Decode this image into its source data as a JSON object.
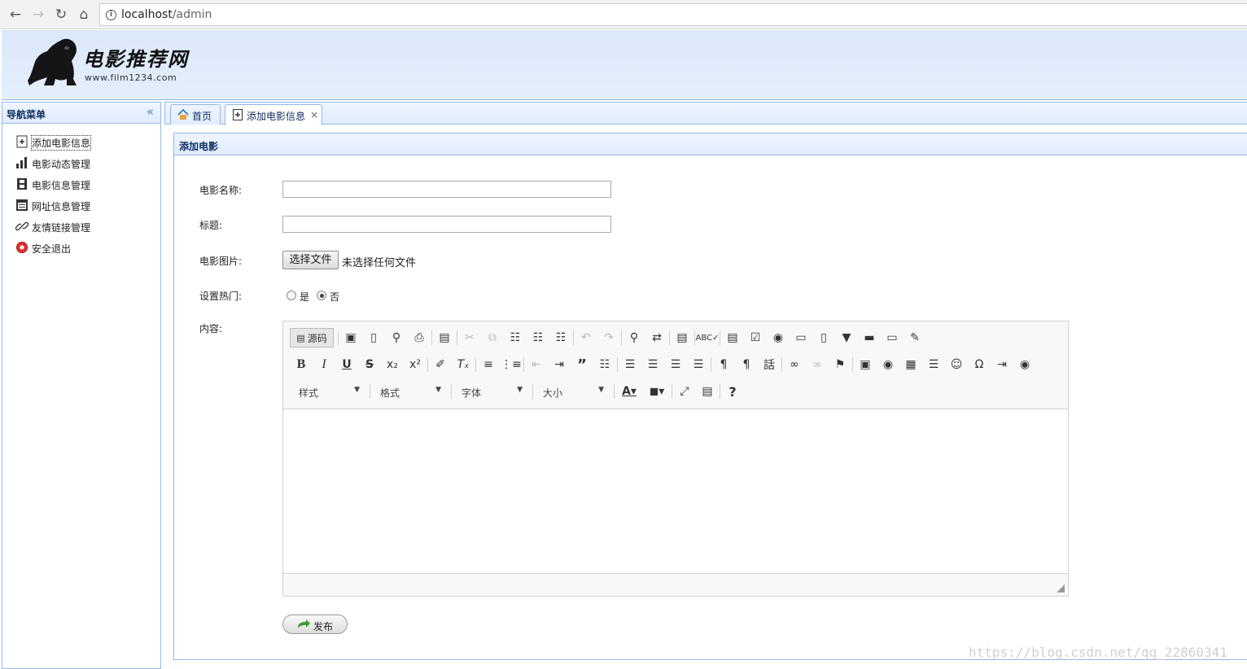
{
  "browser": {
    "url_host": "localhost",
    "url_path": "/admin"
  },
  "header": {
    "site_title": "电影推荐网",
    "site_url": "www.film1234.com"
  },
  "sidebar": {
    "title": "导航菜单",
    "items": [
      {
        "label": "添加电影信息",
        "icon": "add-doc-icon",
        "active": true
      },
      {
        "label": "电影动态管理",
        "icon": "bar-chart-icon"
      },
      {
        "label": "电影信息管理",
        "icon": "film-icon"
      },
      {
        "label": "网址信息管理",
        "icon": "window-icon"
      },
      {
        "label": "友情链接管理",
        "icon": "link-icon"
      },
      {
        "label": "安全退出",
        "icon": "exit-icon"
      }
    ]
  },
  "tabs": [
    {
      "label": "首页",
      "icon": "home-icon"
    },
    {
      "label": "添加电影信息",
      "icon": "add-doc-icon",
      "closable": true,
      "selected": true
    }
  ],
  "panel": {
    "title": "添加电影"
  },
  "form": {
    "name_label": "电影名称:",
    "name_value": "",
    "title_label": "标题:",
    "title_value": "",
    "image_label": "电影图片:",
    "file_button": "选择文件",
    "file_status": "未选择任何文件",
    "hot_label": "设置热门:",
    "hot_yes": "是",
    "hot_no": "否",
    "hot_selected": "否",
    "content_label": "内容:"
  },
  "editor": {
    "source_label": "源码",
    "combos": [
      "样式",
      "格式",
      "字体",
      "大小"
    ]
  },
  "publish_label": "发布",
  "watermark": "https://blog.csdn.net/qq_22860341",
  "colors": {
    "panel_border": "#95b8e7",
    "header_bg": "#dbe8fb"
  }
}
